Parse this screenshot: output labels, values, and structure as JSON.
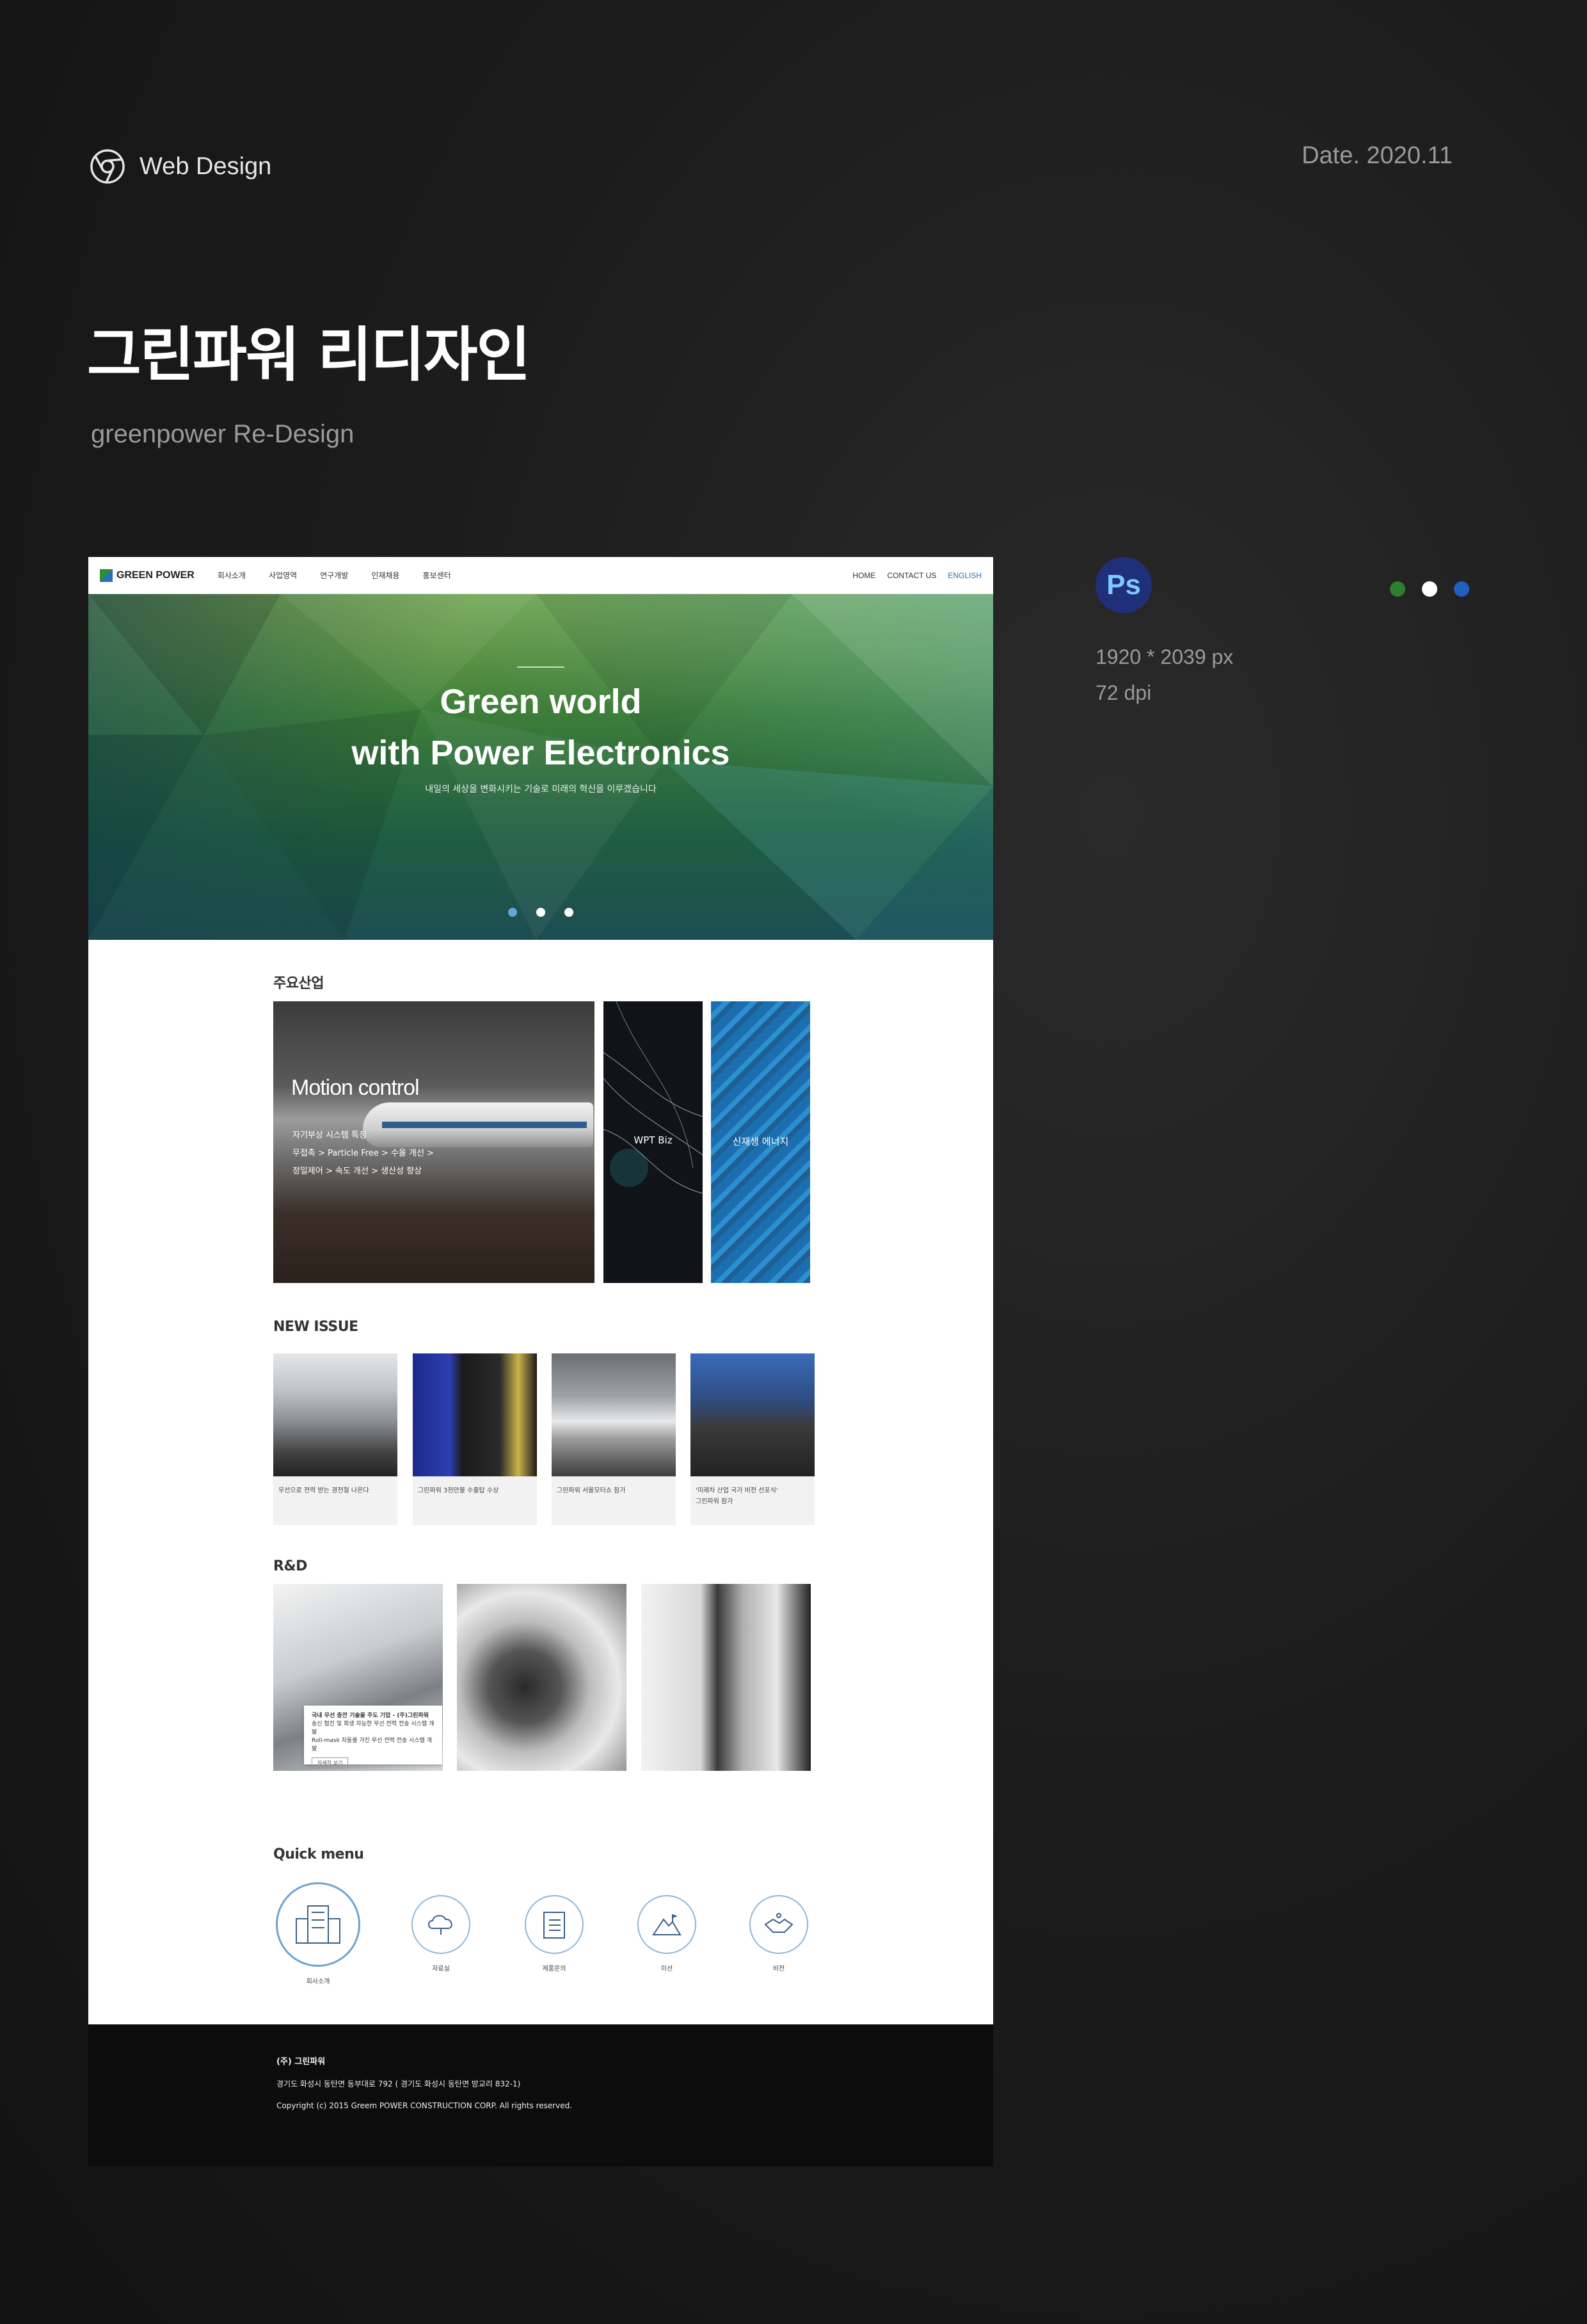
{
  "presentation": {
    "category": "Web Design",
    "date": "Date. 2020.11",
    "title": "그린파워 리디자인",
    "subtitle": "greenpower Re-Design",
    "tool_badge": "Ps",
    "spec_size": "1920 * 2039 px",
    "spec_dpi": "72 dpi",
    "swatches": [
      "#2f7d2f",
      "#ffffff",
      "#1f5fbf"
    ]
  },
  "site": {
    "nav": {
      "logo": "GREEN POWER",
      "menu": [
        "회사소개",
        "사업영역",
        "연구개발",
        "인재채용",
        "홍보센터"
      ],
      "util": [
        "HOME",
        "CONTACT US",
        "ENGLISH"
      ]
    },
    "hero": {
      "title_line1": "Green world",
      "title_line2": "with Power Electronics",
      "subtitle": "내일의 세상을 변화시키는 기술로 미래의 혁신을 이루겠습니다",
      "active_slide": 1,
      "slide_count": 3
    },
    "industry": {
      "section_title": "주요산업",
      "main_title": "Motion control",
      "main_lines": [
        "자기부상 시스템 특징",
        "무접촉 > Particle Free > 수율 개선 >",
        "정밀제어 > 속도 개선 > 생산성 향상"
      ],
      "card2": "WPT Biz",
      "card3": "신재생 에너지"
    },
    "news": {
      "section_title": "NEW ISSUE",
      "items": [
        {
          "caption": "무선으로 전력 받는 경전철 나온다"
        },
        {
          "caption": "그린파워 3천만불 수출탑 수상"
        },
        {
          "caption": "그린파워 서울모터쇼 참가"
        },
        {
          "caption": "'미래차 산업 국가 비전 선포식'",
          "caption2": "그린파워 참가"
        }
      ]
    },
    "rnd": {
      "section_title": "R&D",
      "box_title": "국내 무선 충전 기술을 주도 기업 - (주)그린파워",
      "box_line1": "송신 협진 및 회생 자능한 무선 전력 전송 시스템 개발",
      "box_line2": "Roll-mask 자동를 가진 무선 전력 전송 시스템 개발",
      "box_button": "자세히 보기"
    },
    "quick": {
      "section_title": "Quick menu",
      "items": [
        "회사소개",
        "자료실",
        "제품문의",
        "미션",
        "비전"
      ]
    },
    "footer": {
      "company": "(주) 그린파워",
      "address": "경기도 화성시 동탄면 동부대로 792 ( 경기도 화성시 동탄면 방교리 832-1)",
      "copyright": "Copyright (c) 2015 Greem POWER CONSTRUCTION CORP. All rights reserved."
    }
  }
}
